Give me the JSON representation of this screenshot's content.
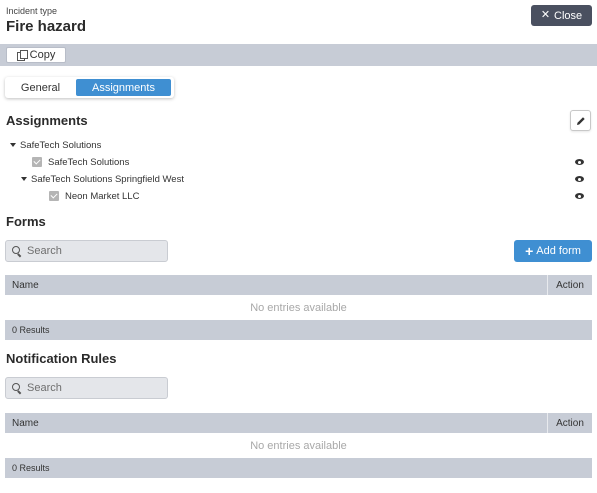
{
  "header": {
    "incident_label": "Incident type",
    "title": "Fire hazard",
    "close_label": "Close",
    "close_icon": "close-icon"
  },
  "toolbar": {
    "copy_label": "Copy",
    "copy_icon": "copy-icon"
  },
  "tabs": [
    {
      "label": "General",
      "active": false
    },
    {
      "label": "Assignments",
      "active": true
    }
  ],
  "assignments": {
    "title": "Assignments",
    "edit_icon": "pencil-icon",
    "tree": [
      {
        "label": "SafeTech Solutions",
        "type": "group"
      },
      {
        "label": "SafeTech Solutions",
        "type": "item",
        "checked": true
      },
      {
        "label": "SafeTech Solutions Springfield West",
        "type": "group"
      },
      {
        "label": "Neon Market LLC",
        "type": "item",
        "checked": true
      }
    ]
  },
  "forms": {
    "title": "Forms",
    "search_placeholder": "Search",
    "add_label": "Add form",
    "columns": [
      "Name",
      "Action"
    ],
    "empty_text": "No entries available",
    "results_text": "0 Results"
  },
  "notification_rules": {
    "title": "Notification Rules",
    "search_placeholder": "Search",
    "columns": [
      "Name",
      "Action"
    ],
    "empty_text": "No entries available",
    "results_text": "0 Results"
  },
  "colors": {
    "accent": "#3f8fd2",
    "close_button": "#4a5060",
    "bar": "#c7ccd6"
  }
}
